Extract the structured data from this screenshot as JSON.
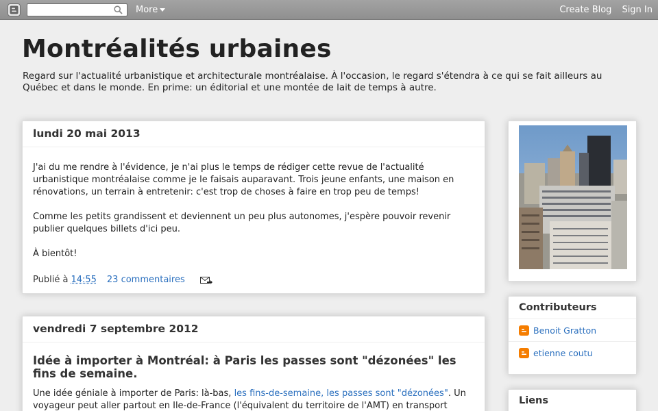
{
  "navbar": {
    "search_value": "",
    "more_label": "More",
    "create_blog": "Create Blog",
    "sign_in": "Sign In"
  },
  "header": {
    "title": "Montréalités urbaines",
    "description": "Regard sur l'actualité urbanistique et architecturale montréalaise. À l'occasion, le regard s'étendra à ce qui se fait ailleurs au Québec et dans le monde. En prime: un éditorial et une montée de lait de temps à autre."
  },
  "posts": [
    {
      "date": "lundi 20 mai 2013",
      "paragraphs": [
        "J'ai du me rendre à l'évidence, je n'ai plus le temps de rédiger cette revue de l'actualité urbanistique montréalaise comme je le faisais auparavant.  Trois jeune enfants, une maison en rénovations, un terrain à entretenir: c'est trop de choses à faire en trop peu de temps!",
        "Comme les petits grandissent et deviennent un peu plus autonomes, j'espère pouvoir revenir publier quelques billets d'ici peu.",
        "À bientôt!"
      ],
      "published_label": "Publié à",
      "time": "14:55",
      "comments": "23 commentaires"
    },
    {
      "date": "vendredi 7 septembre 2012",
      "title": "Idée à importer à Montréal: à Paris les passes sont \"dézonées\" les fins de semaine.",
      "body_start": "Une idée géniale à importer de Paris: là-bas, ",
      "body_link": "les fins-de-semaine, les passes sont \"dézonées\"",
      "body_end": ". Un voyageur peut aller partout en Ile-de-France (l'équivalent du territoire de l'AMT) en transport collectif avec n'importe quel titre de transport..."
    }
  ],
  "sidebar": {
    "contributors_title": "Contributeurs",
    "contributors": [
      "Benoit Gratton",
      "etienne coutu"
    ],
    "links_title": "Liens"
  },
  "colors": {
    "link": "#2a6fbe",
    "navbar": "#999999",
    "blogger_orange": "#f57d00"
  }
}
